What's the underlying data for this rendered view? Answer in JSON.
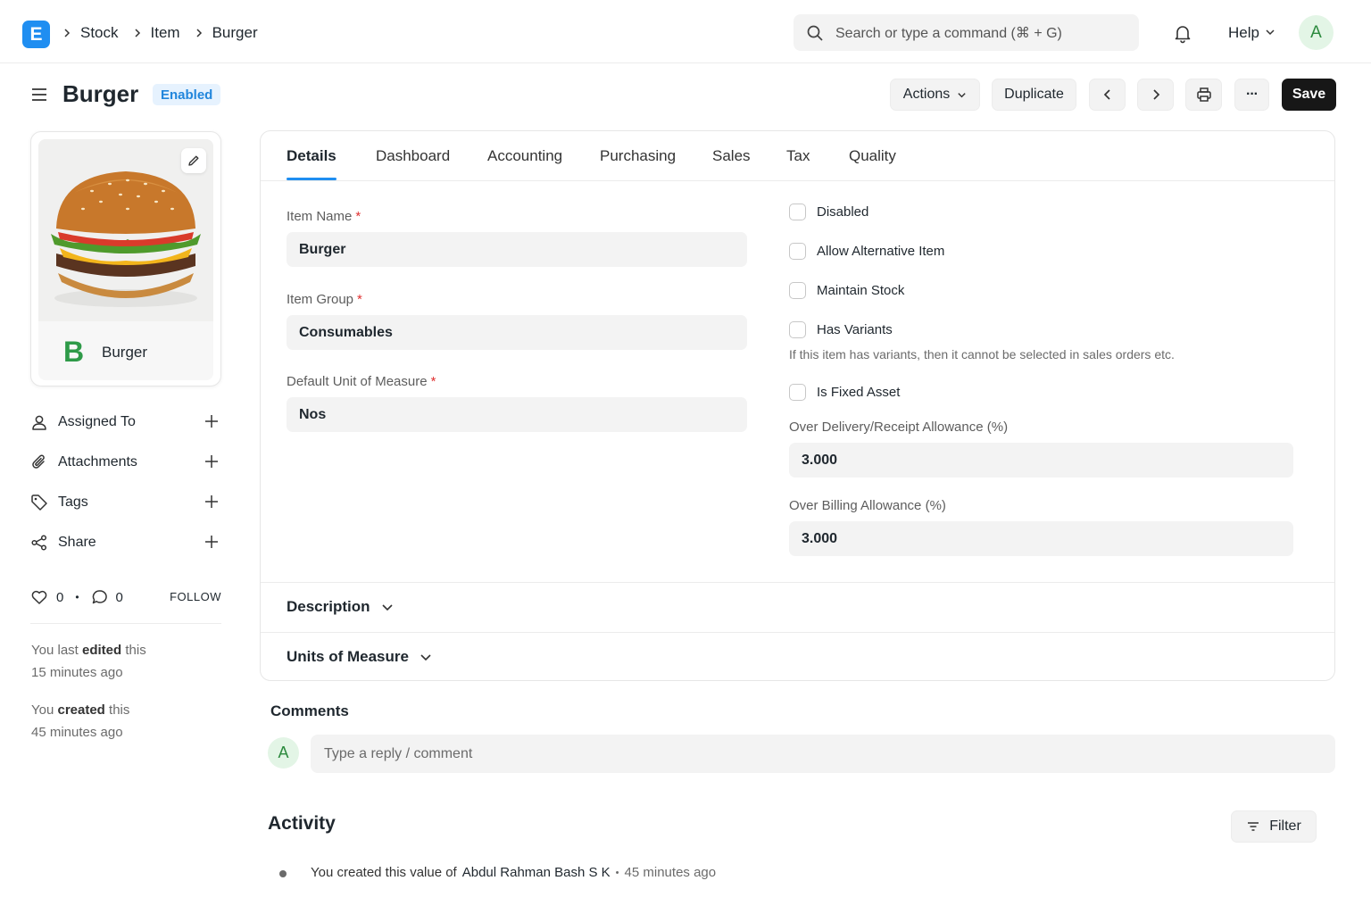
{
  "brand": {
    "letter": "E",
    "color": "#1f8ef1"
  },
  "breadcrumbs": [
    "Stock",
    "Item",
    "Burger"
  ],
  "search": {
    "placeholder": "Search or type a command (⌘ + G)"
  },
  "navbar": {
    "help_label": "Help",
    "avatar_letter": "A"
  },
  "page": {
    "title": "Burger",
    "status_badge": "Enabled"
  },
  "toolbar": {
    "actions_label": "Actions",
    "duplicate_label": "Duplicate",
    "save_label": "Save",
    "more_label": "···"
  },
  "sidebar": {
    "image_letter": "B",
    "image_name": "Burger",
    "items": [
      {
        "label": "Assigned To",
        "icon": "user-icon"
      },
      {
        "label": "Attachments",
        "icon": "paperclip-icon"
      },
      {
        "label": "Tags",
        "icon": "tag-icon"
      },
      {
        "label": "Share",
        "icon": "share-icon"
      }
    ],
    "likes_count": "0",
    "comments_count": "0",
    "follow_label": "FOLLOW",
    "edited_prefix": "You last ",
    "edited_word": "edited",
    "edited_suffix": " this",
    "edited_time": "15 minutes ago",
    "created_prefix": "You ",
    "created_word": "created",
    "created_suffix": " this",
    "created_time": "45 minutes ago"
  },
  "tabs": [
    "Details",
    "Dashboard",
    "Accounting",
    "Purchasing",
    "Sales",
    "Tax",
    "Quality"
  ],
  "form": {
    "item_name": {
      "label": "Item Name",
      "value": "Burger"
    },
    "item_group": {
      "label": "Item Group",
      "value": "Consumables"
    },
    "uom": {
      "label": "Default Unit of Measure",
      "value": "Nos"
    },
    "required_mark": "*",
    "checkboxes": [
      {
        "label": "Disabled",
        "checked": false
      },
      {
        "label": "Allow Alternative Item",
        "checked": false
      },
      {
        "label": "Maintain Stock",
        "checked": false
      },
      {
        "label": "Has Variants",
        "checked": false
      },
      {
        "label": "Is Fixed Asset",
        "checked": false
      }
    ],
    "variants_help": "If this item has variants, then it cannot be selected in sales orders etc.",
    "over_delivery": {
      "label": "Over Delivery/Receipt Allowance (%)",
      "value": "3.000"
    },
    "over_billing": {
      "label": "Over Billing Allowance (%)",
      "value": "3.000"
    }
  },
  "sections": [
    "Description",
    "Units of Measure"
  ],
  "comments": {
    "title": "Comments",
    "avatar_letter": "A",
    "placeholder": "Type a reply / comment"
  },
  "activity": {
    "title": "Activity",
    "filter_label": "Filter",
    "entry_text": "You created this value of",
    "entry_user": "Abdul Rahman Bash S K",
    "entry_sep": "•",
    "entry_time": "45 minutes ago"
  },
  "colors": {
    "accent": "#1f8ef1",
    "badge_bg": "#e6f2fe",
    "badge_fg": "#2186dc",
    "save_bg": "#171717",
    "avatar_bg": "#e3f5e6",
    "avatar_fg": "#2c8a3e",
    "required": "#e03131"
  }
}
